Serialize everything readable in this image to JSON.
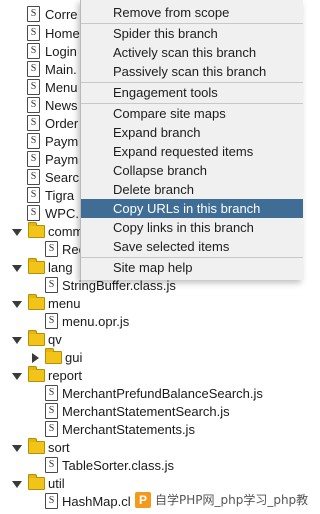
{
  "tree": {
    "files_top": [
      "Corre",
      "Home",
      "Login",
      "Main.",
      "Menu",
      "News",
      "Order",
      "Paym",
      "Paym",
      "Searc",
      "Tigra",
      "WPC."
    ],
    "folders": {
      "comm": "comm",
      "comm_child": "Rec",
      "lang": "lang",
      "lang_child": "StringBuffer.class.js",
      "menu": "menu",
      "menu_child": "menu.opr.js",
      "qv": "qv",
      "gui": "gui",
      "report": "report",
      "report_children": [
        "MerchantPrefundBalanceSearch.js",
        "MerchantStatementSearch.js",
        "MerchantStatements.js"
      ],
      "sort": "sort",
      "sort_child": "TableSorter.class.js",
      "util": "util",
      "util_child": "HashMap.cl"
    },
    "file_icon_glyph": "S"
  },
  "context_menu": {
    "items": [
      "Remove from scope",
      "Spider this branch",
      "Actively scan this branch",
      "Passively scan this branch",
      "Engagement tools",
      "Compare site maps",
      "Expand branch",
      "Expand requested items",
      "Collapse branch",
      "Delete branch",
      "Copy URLs in this branch",
      "Copy links in this branch",
      "Save selected items",
      "Site map help"
    ],
    "selected_index": 10
  },
  "watermark": {
    "logo": "P",
    "text": "自学PHP网_php学习_php教"
  }
}
